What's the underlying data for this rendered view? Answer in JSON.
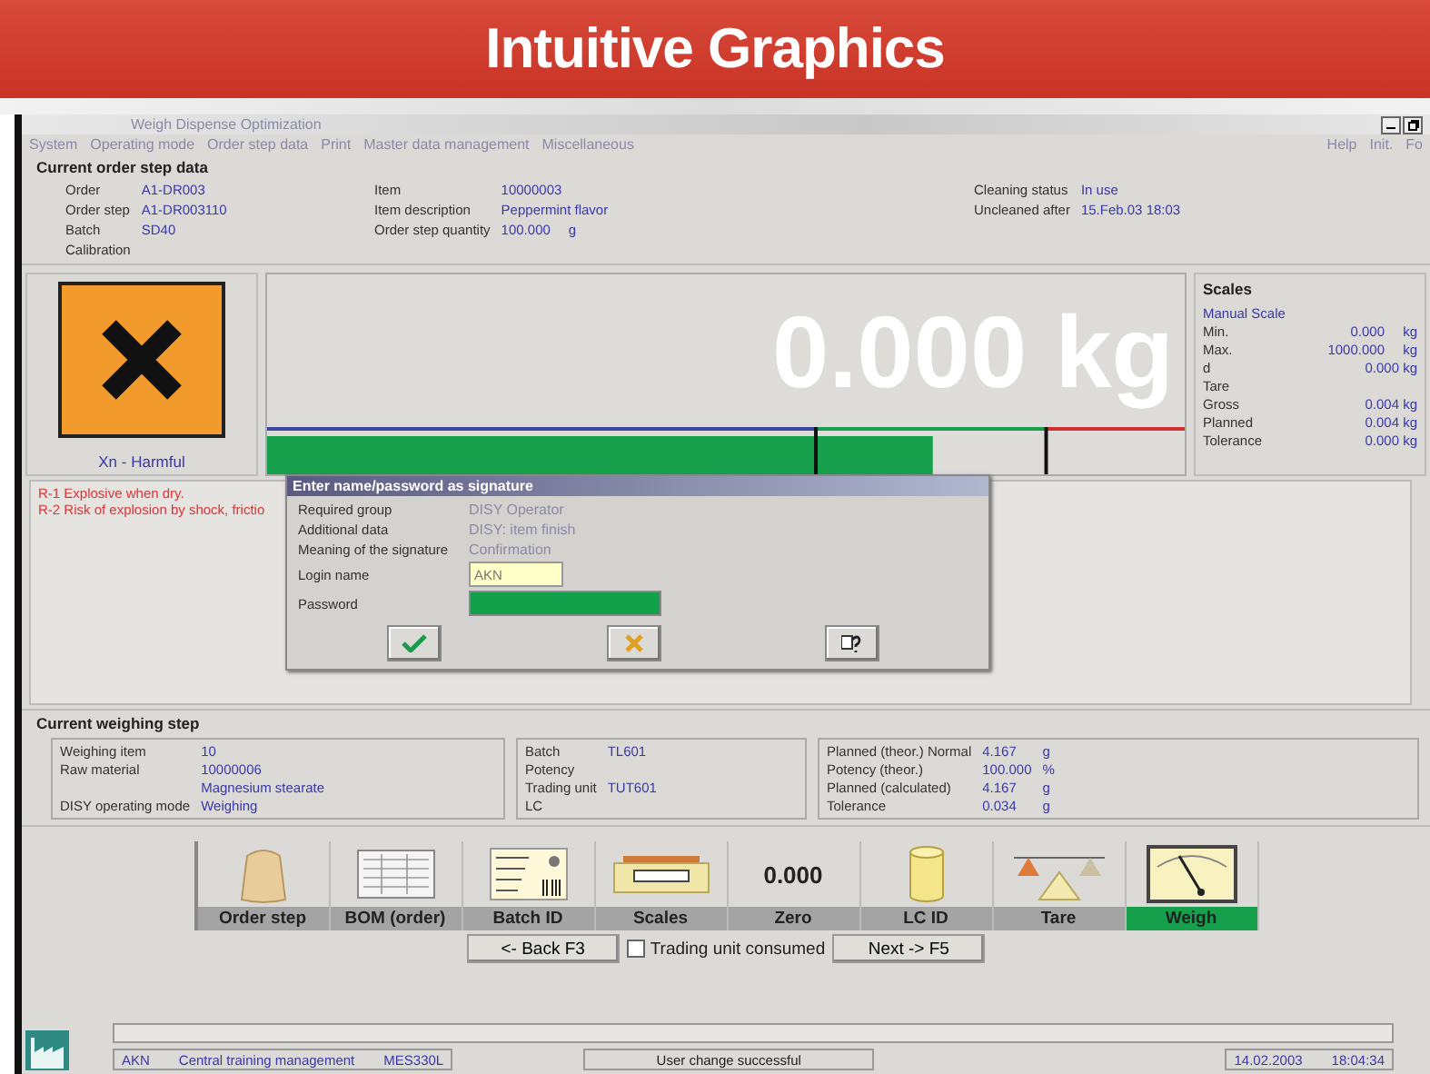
{
  "banner": {
    "title": "Intuitive Graphics"
  },
  "window": {
    "title": "Weigh Dispense Optimization"
  },
  "menu": {
    "items": [
      "System",
      "Operating mode",
      "Order step data",
      "Print",
      "Master data management",
      "Miscellaneous"
    ],
    "right_items": [
      "Help",
      "Init.",
      "Fo"
    ]
  },
  "order_step": {
    "title": "Current order step data",
    "columns": [
      [
        {
          "label": "Order",
          "value": "A1-DR003"
        },
        {
          "label": "Order step",
          "value": "A1-DR003110"
        },
        {
          "label": "Batch",
          "value": "SD40"
        },
        {
          "label": "Calibration"
        }
      ],
      [
        {
          "label": "Item",
          "value": "10000003"
        },
        {
          "label": "Item description",
          "value": "Peppermint flavor"
        },
        {
          "label": "Order step quantity",
          "value": "100.000",
          "unit": "g"
        }
      ],
      [
        {
          "label": "Cleaning status",
          "value": "In use"
        },
        {
          "label": "Uncleaned after",
          "value": "15.Feb.03 18:03"
        }
      ]
    ]
  },
  "hazard": {
    "label": "Xn - Harmful"
  },
  "display": {
    "reading": "0.000 kg"
  },
  "scales": {
    "title": "Scales",
    "subtitle": "Manual Scale",
    "rows": [
      {
        "label": "Min.",
        "value": "0.000",
        "unit": "kg"
      },
      {
        "label": "Max.",
        "value": "1000.000",
        "unit": "kg"
      },
      {
        "label": "d",
        "value": "0.000 kg"
      },
      {
        "label": "Tare"
      },
      {
        "label": "Gross",
        "value": "0.004 kg"
      },
      {
        "label": "Planned",
        "value": "0.004 kg"
      },
      {
        "label": "Tolerance",
        "value": "0.000 kg"
      }
    ]
  },
  "risks": [
    "R-1 Explosive when dry.",
    "R-2 Risk of explosion by shock, frictio"
  ],
  "dialog": {
    "title": "Enter name/password as signature",
    "rows": [
      {
        "label": "Required group",
        "value": "DISY Operator"
      },
      {
        "label": "Additional data",
        "value": "DISY: item finish"
      },
      {
        "label": "Meaning of the signature",
        "value": "Confirmation"
      }
    ],
    "login_label": "Login name",
    "login_value": "AKN",
    "password_label": "Password",
    "buttons": [
      {
        "kind": "ok"
      },
      {
        "kind": "cancel"
      },
      {
        "kind": "help"
      }
    ]
  },
  "weighing_step": {
    "title": "Current weighing step",
    "groups": [
      [
        {
          "label": "Weighing item",
          "value": "10"
        },
        {
          "label": "Raw material",
          "value": "10000006"
        },
        {
          "value": "Magnesium stearate"
        },
        {
          "label": "DISY operating mode",
          "value": "Weighing"
        }
      ],
      [
        {
          "label": "Batch",
          "value": "TL601"
        },
        {
          "label": "Potency"
        },
        {
          "label": "Trading unit",
          "value": "TUT601"
        },
        {
          "label": "LC"
        }
      ],
      [
        {
          "label": "Planned (theor.) Normal",
          "value": "4.167",
          "unit": "g"
        },
        {
          "label": "Potency (theor.)",
          "value": "100.000",
          "unit": "%"
        },
        {
          "label": "Planned (calculated)",
          "value": "4.167",
          "unit": "g"
        },
        {
          "label": "Tolerance",
          "value": "0.034",
          "unit": "g"
        }
      ]
    ]
  },
  "toolbar": {
    "items": [
      {
        "label": "Order step",
        "kind": "bag",
        "selected": false
      },
      {
        "label": "BOM (order)",
        "kind": "table",
        "selected": false
      },
      {
        "label": "Batch ID",
        "kind": "label",
        "selected": false
      },
      {
        "label": "Scales",
        "kind": "scale",
        "selected": false
      },
      {
        "label": "Zero",
        "kind": "zero",
        "display": "0.000",
        "selected": false
      },
      {
        "label": "LC ID",
        "kind": "container",
        "selected": false
      },
      {
        "label": "Tare",
        "kind": "balance",
        "selected": false
      },
      {
        "label": "Weigh",
        "kind": "gauge",
        "selected": true
      }
    ]
  },
  "nav": {
    "back": "<- Back F3",
    "checkbox": {
      "label": "Trading unit consumed",
      "checked": false
    },
    "next": "Next -> F5"
  },
  "status": {
    "fields": [
      "AKN",
      "Central training management",
      "MES330L"
    ],
    "message": "User change successful",
    "date": "14.02.2003",
    "time": "18:04:34"
  }
}
